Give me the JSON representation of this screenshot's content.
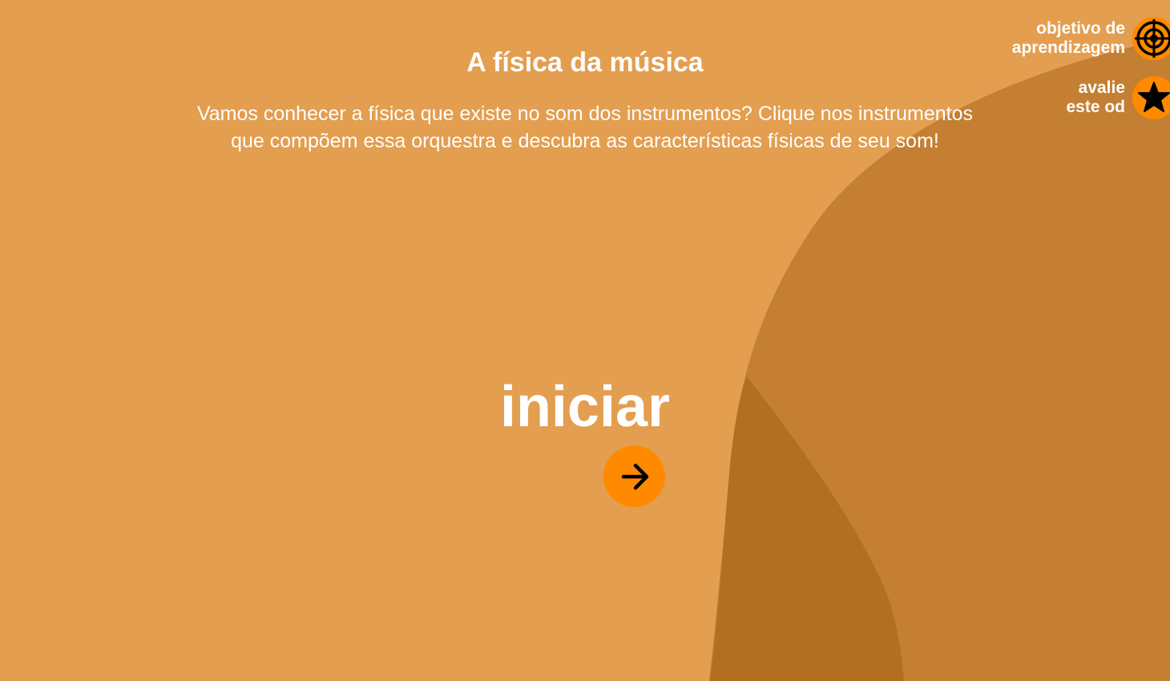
{
  "page": {
    "title": "A física da música",
    "description": "Vamos conhecer a física que existe no som dos instrumentos? Clique nos instrumentos que compõem essa orquestra e descubra as características físicas de seu som!",
    "start_label": "iniciar"
  },
  "side_menu": {
    "objective": {
      "line1": "objetivo de",
      "line2": "aprendizagem",
      "icon": "target-icon"
    },
    "rate": {
      "line1": "avalie",
      "line2": "este od",
      "icon": "star-icon"
    }
  },
  "colors": {
    "background": "#e39e4f",
    "shape_mid": "#c47f33",
    "shape_dark": "#b36f21",
    "accent": "#ff8a00",
    "text": "#ffffff"
  }
}
